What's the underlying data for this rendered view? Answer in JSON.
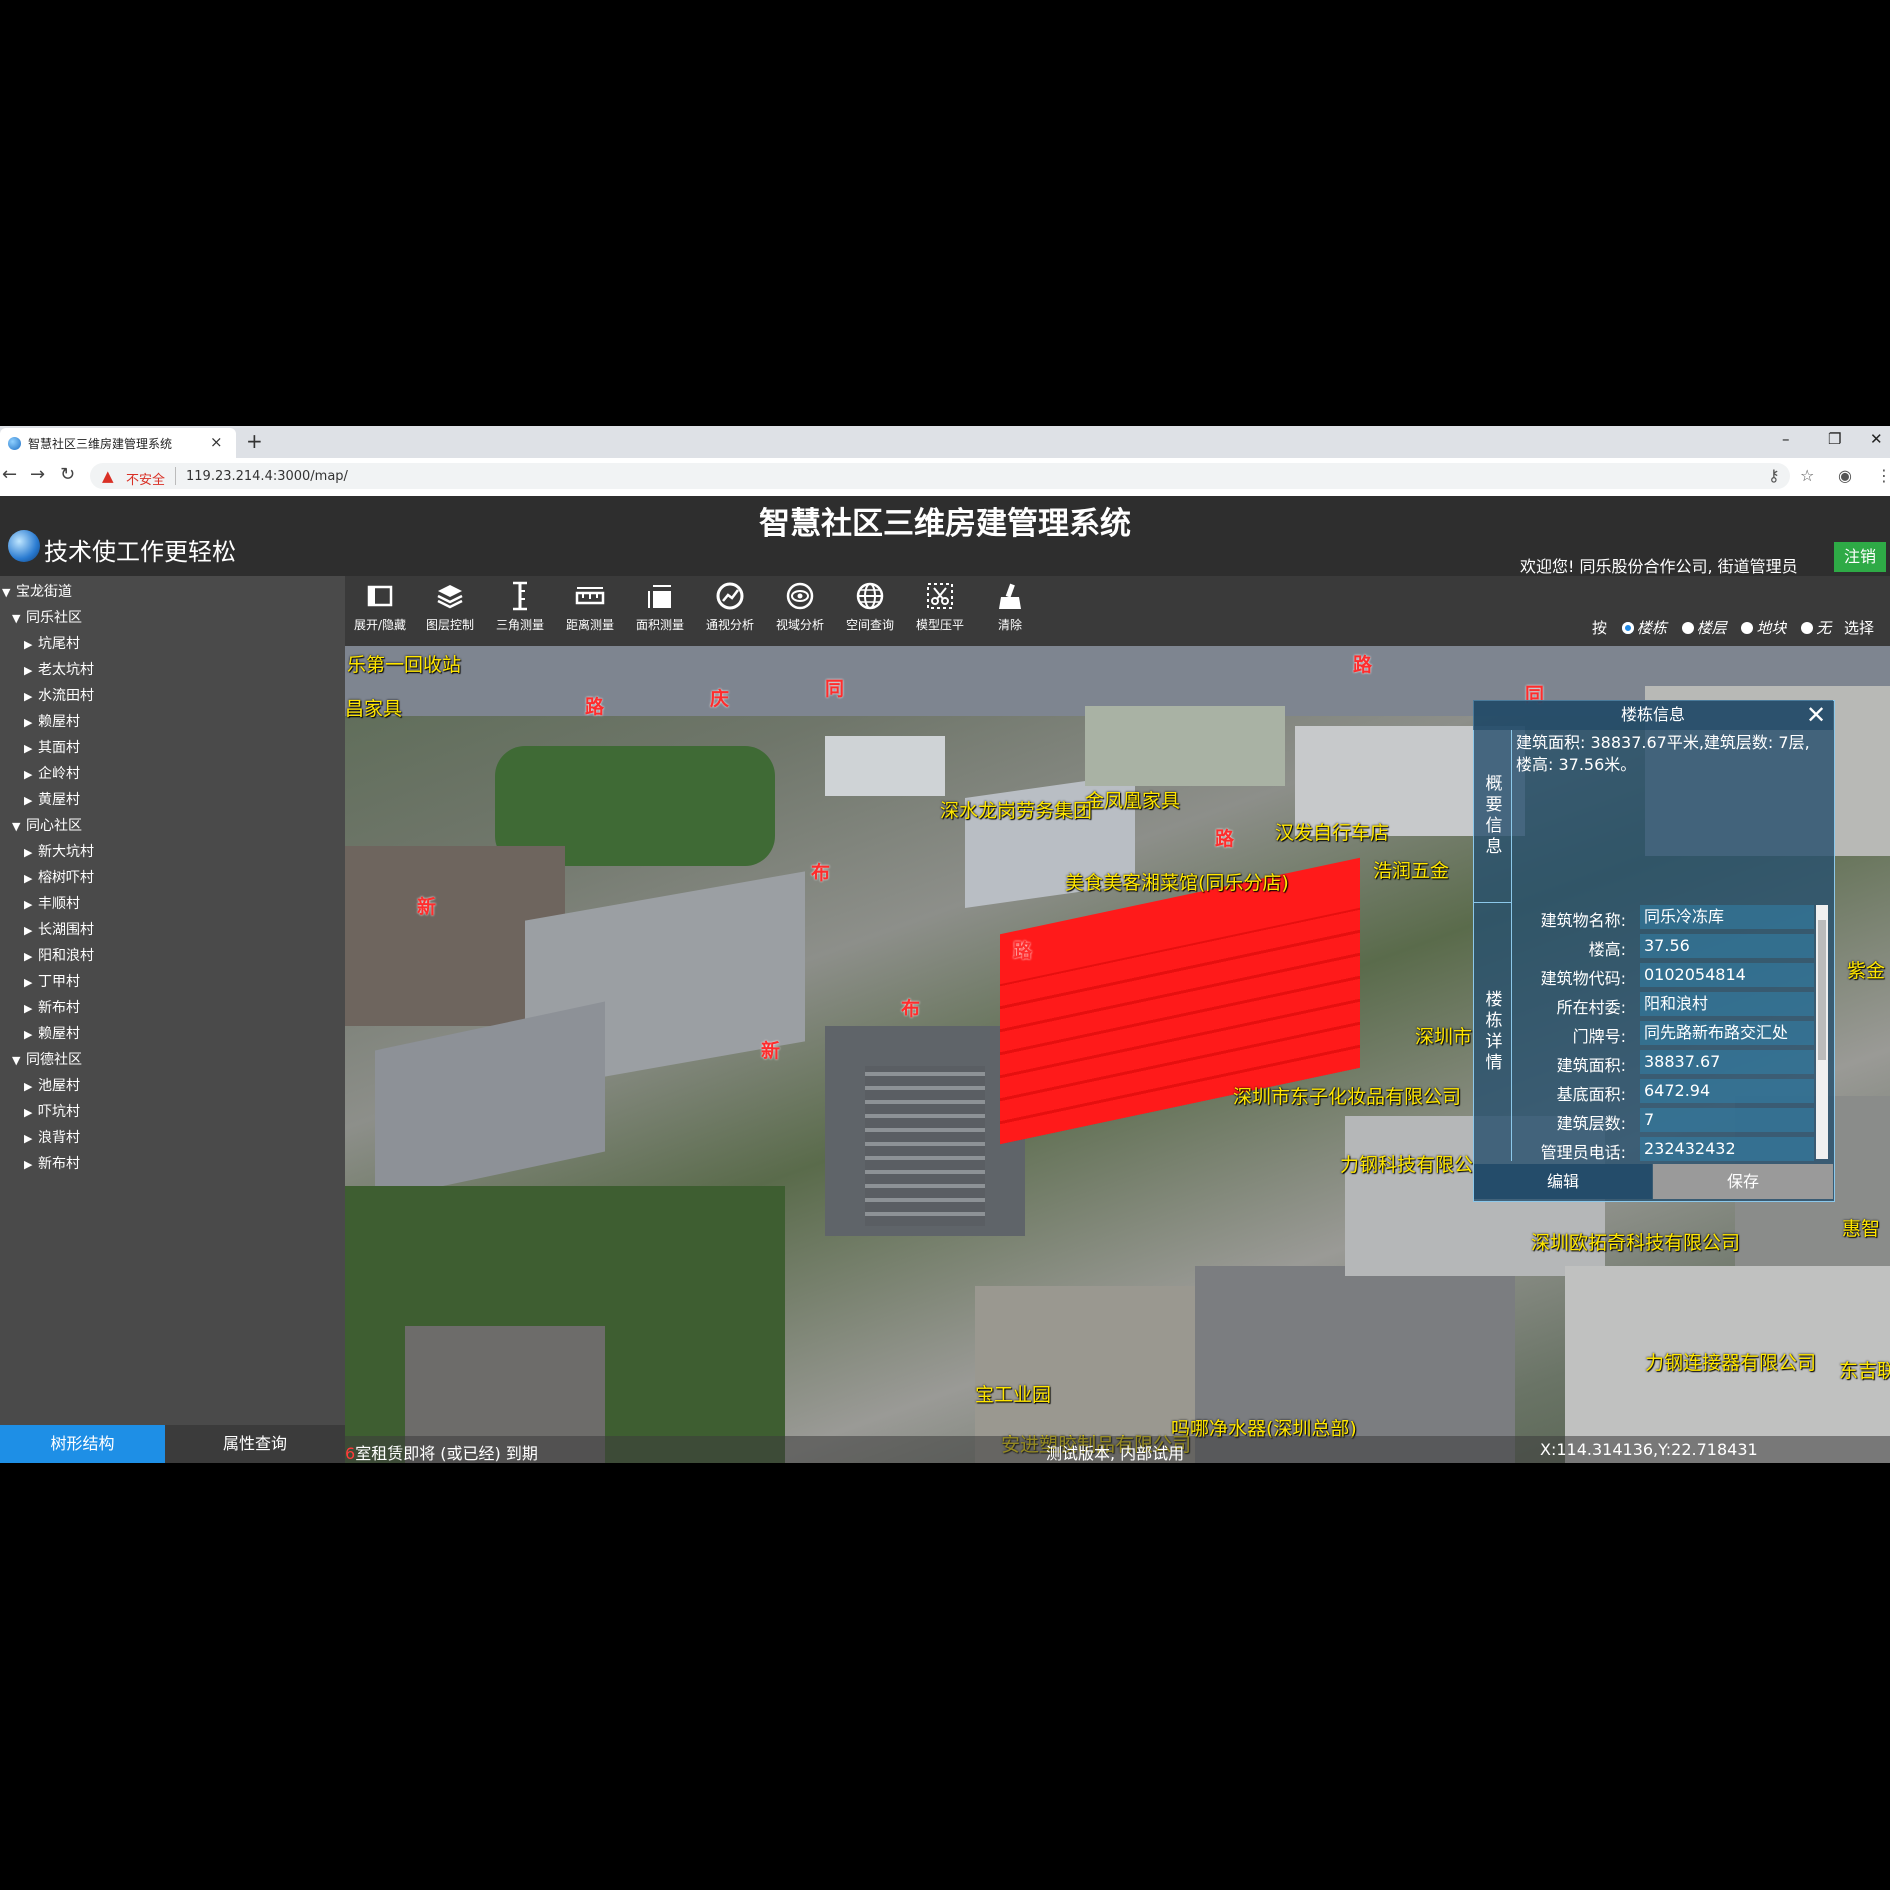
{
  "browser": {
    "tab_title": "智慧社区三维房建管理系统",
    "tab_close": "×",
    "new_tab": "+",
    "insecure_label": "不安全",
    "url": "119.23.214.4:3000/map/",
    "window_controls": [
      "–",
      "❐",
      "✕"
    ]
  },
  "header": {
    "title": "智慧社区三维房建管理系统",
    "slogan": "技术使工作更轻松",
    "welcome": "欢迎您! 同乐股份合作公司, 街道管理员",
    "logout": "注销"
  },
  "tree": {
    "root": "宝龙街道",
    "groups": [
      {
        "label": "同乐社区",
        "children": [
          "坑尾村",
          "老太坑村",
          "水流田村",
          "赖屋村",
          "其面村",
          "企岭村",
          "黄屋村"
        ]
      },
      {
        "label": "同心社区",
        "children": [
          "新大坑村",
          "榕树吓村",
          "丰顺村",
          "长湖围村",
          "阳和浪村",
          "丁甲村",
          "新布村",
          "赖屋村"
        ]
      },
      {
        "label": "同德社区",
        "children": [
          "池屋村",
          "吓坑村",
          "浪背村",
          "新布村"
        ]
      }
    ]
  },
  "sidebar_tabs": {
    "tree": "树形结构",
    "attribute": "属性查询"
  },
  "toolbar": {
    "tools": [
      {
        "label": "展开/隐藏",
        "icon": "expand-hide-icon"
      },
      {
        "label": "图层控制",
        "icon": "layers-icon"
      },
      {
        "label": "三角测量",
        "icon": "triangle-measure-icon"
      },
      {
        "label": "距离测量",
        "icon": "distance-measure-icon"
      },
      {
        "label": "面积测量",
        "icon": "area-measure-icon"
      },
      {
        "label": "通视分析",
        "icon": "sightline-analysis-icon"
      },
      {
        "label": "视域分析",
        "icon": "viewshed-analysis-icon"
      },
      {
        "label": "空间查询",
        "icon": "spatial-query-icon"
      },
      {
        "label": "模型压平",
        "icon": "model-flatten-icon"
      },
      {
        "label": "清除",
        "icon": "clear-brush-icon"
      }
    ],
    "select_by": {
      "prefix": "按",
      "options": [
        "楼栋",
        "楼层",
        "地块",
        "无"
      ],
      "selected": "楼栋",
      "suffix": "选择"
    }
  },
  "map_labels": {
    "places": [
      "乐第一回收站",
      "昌家具",
      "金凤凰家具",
      "美食美客湘菜馆(同乐分店)",
      "汉发自行车店",
      "深圳市东子化妆品有限公司",
      "力钢科技有限公",
      "深圳欧拓奇科技有限公司",
      "力钢连接器有限公司",
      "宝工业园",
      "吗哪净水器(深圳总部)",
      "安进塑胶制品有限公司",
      "紫金",
      "惠智",
      "东吉联",
      "深圳市",
      "浩润五金",
      "深水龙岗劳务集团"
    ],
    "roads": [
      "路",
      "庆",
      "同",
      "布",
      "新",
      "路",
      "新",
      "布",
      "路",
      "同",
      "路"
    ]
  },
  "highlighted_building_color": "#ff1a1a",
  "info_panel": {
    "title": "楼栋信息",
    "close": "✕",
    "summary_side": "概要信息",
    "summary_text": "建筑面积: 38837.67平米,建筑层数: 7层, 楼高: 37.56米。",
    "detail_side": "楼栋详情",
    "details": [
      {
        "key": "建筑物名称:",
        "value": "同乐冷冻库"
      },
      {
        "key": "楼高:",
        "value": "37.56"
      },
      {
        "key": "建筑物代码:",
        "value": "0102054814"
      },
      {
        "key": "所在村委:",
        "value": "阳和浪村"
      },
      {
        "key": "门牌号:",
        "value": "同先路新布路交汇处"
      },
      {
        "key": "建筑面积:",
        "value": "38837.67"
      },
      {
        "key": "基底面积:",
        "value": "6472.94"
      },
      {
        "key": "建筑层数:",
        "value": "7"
      },
      {
        "key": "管理员电话:",
        "value": "232432432"
      }
    ],
    "edit": "编辑",
    "save": "保存"
  },
  "status": {
    "left_prefix": "6",
    "left": "室租赁即将 (或已经) 到期",
    "center": "测试版本, 内部试用",
    "coords": "X:114.314136,Y:22.718431"
  }
}
